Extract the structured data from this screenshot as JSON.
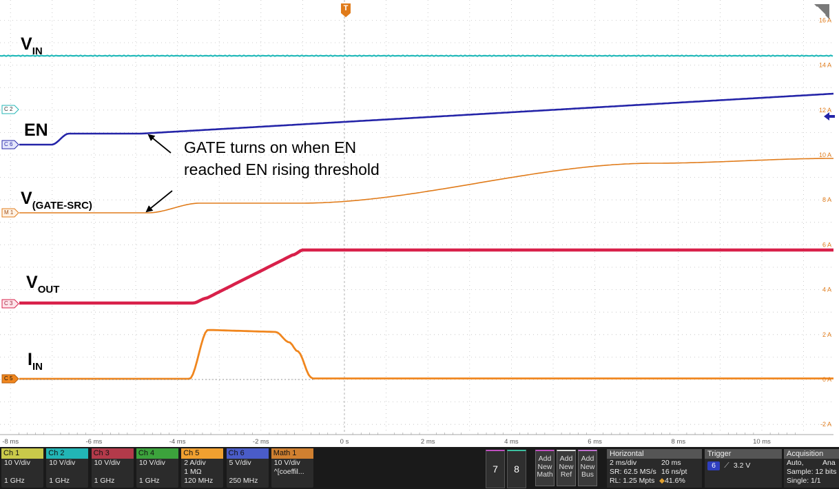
{
  "time_axis": {
    "labels": [
      "-8 ms",
      "-6 ms",
      "-4 ms",
      "-2 ms",
      "0 s",
      "2 ms",
      "4 ms",
      "6 ms",
      "8 ms",
      "10 ms"
    ],
    "values": [
      -8,
      -6,
      -4,
      -2,
      0,
      2,
      4,
      6,
      8,
      10
    ]
  },
  "right_scale": {
    "labels": [
      "16 A",
      "14 A",
      "12 A",
      "10 A",
      "8 A",
      "6 A",
      "4 A",
      "2 A",
      "0 A",
      "-2 A"
    ],
    "values": [
      16,
      14,
      12,
      10,
      8,
      6,
      4,
      2,
      0,
      -2
    ],
    "color": "#e07b1a"
  },
  "trigger_marker": "T",
  "channel_markers": {
    "c2": "C 2",
    "c6": "C 6",
    "m1": "M 1",
    "c3": "C 3",
    "c5": "C 5"
  },
  "trace_labels": {
    "vin_main": "V",
    "vin_sub": "IN",
    "en": "EN",
    "vgate_main": "V",
    "vgate_sub": "(GATE-SRC)",
    "vout_main": "V",
    "vout_sub": "OUT",
    "iin_main": "I",
    "iin_sub": "IN"
  },
  "annotation": {
    "line1": "GATE turns on when EN",
    "line2": "reached EN rising threshold"
  },
  "colors": {
    "vin": "#1fb8b8",
    "en": "#2424a8",
    "vgate": "#e07b1a",
    "vout": "#d8204a",
    "iin": "#f0861e",
    "grid": "#bdbdbd"
  },
  "channels": [
    {
      "name": "Ch 1",
      "line1": "10 V/div",
      "line2": "",
      "line3": "1 GHz",
      "color": "#c9c94a"
    },
    {
      "name": "Ch 2",
      "line1": "10 V/div",
      "line2": "",
      "line3": "1 GHz",
      "color": "#22b5b5"
    },
    {
      "name": "Ch 3",
      "line1": "10 V/div",
      "line2": "",
      "line3": "1 GHz",
      "color": "#b33a4a"
    },
    {
      "name": "Ch 4",
      "line1": "10 V/div",
      "line2": "",
      "line3": "1 GHz",
      "color": "#3ca33c"
    },
    {
      "name": "Ch 5",
      "line1": "2 A/div",
      "line2": "1 MΩ",
      "line3": "120 MHz",
      "color": "#f0a030"
    },
    {
      "name": "Ch 6",
      "line1": "5 V/div",
      "line2": "",
      "line3": "250 MHz",
      "color": "#4a5cc8"
    },
    {
      "name": "Math 1",
      "line1": "10 V/div",
      "line2": "^[coeffil...",
      "line3": "",
      "color": "#d08030"
    }
  ],
  "buttons": {
    "b7": "7",
    "b8": "8",
    "add_math": [
      "Add",
      "New",
      "Math"
    ],
    "add_ref": [
      "Add",
      "New",
      "Ref"
    ],
    "add_bus": [
      "Add",
      "New",
      "Bus"
    ]
  },
  "horizontal": {
    "title": "Horizontal",
    "scale": "2 ms/div",
    "duration": "20 ms",
    "sample_rate": "SR: 62.5 MS/s",
    "ns_pt": "16 ns/pt",
    "record_length": "RL: 1.25 Mpts",
    "position": "41.6%"
  },
  "trigger": {
    "title": "Trigger",
    "source": "6",
    "level": "3.2 V"
  },
  "acquisition": {
    "title": "Acquisition",
    "mode": "Auto,",
    "mode_extra": "Ana",
    "sample": "Sample: 12 bits",
    "single": "Single: 1/1"
  }
}
